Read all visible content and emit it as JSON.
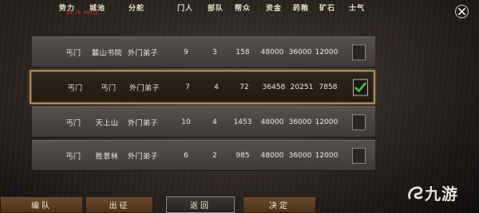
{
  "colors": {
    "header_text": "#e9dfc8",
    "row_text": "#efe9de",
    "selected_border": "#b08a52",
    "check_green": "#52b83a",
    "red_line": "#d83a2a",
    "button_brown": "#5b3e24"
  },
  "header": {
    "columns": [
      "势力",
      "城池",
      "分舵",
      "门人",
      "部队",
      "帮众",
      "资金",
      "药粮",
      "矿石",
      "士气"
    ],
    "red_line": "SB-29 00512"
  },
  "close_icon": "close-icon",
  "rows": [
    {
      "faction": "丐门",
      "city": "麓山书院",
      "branch": "外门弟子",
      "members": "9",
      "troops": "3",
      "crew": "158",
      "funds": "48000",
      "medicine": "36000",
      "ore": "12000",
      "checked": false
    },
    {
      "faction": "丐门",
      "city": "丐门",
      "branch": "外门弟子",
      "members": "7",
      "troops": "4",
      "crew": "72",
      "funds": "36458",
      "medicine": "20251",
      "ore": "7858",
      "checked": true
    },
    {
      "faction": "丐门",
      "city": "天上山",
      "branch": "外门弟子",
      "members": "10",
      "troops": "4",
      "crew": "1453",
      "funds": "48000",
      "medicine": "36000",
      "ore": "12000",
      "checked": false
    },
    {
      "faction": "丐门",
      "city": "胜景林",
      "branch": "外门弟子",
      "members": "6",
      "troops": "2",
      "crew": "985",
      "funds": "48000",
      "medicine": "36000",
      "ore": "12000",
      "checked": false
    }
  ],
  "buttons": {
    "edit": "编队",
    "march": "出征",
    "back": "返回",
    "confirm": "决定"
  },
  "watermark": {
    "text": "九游"
  }
}
